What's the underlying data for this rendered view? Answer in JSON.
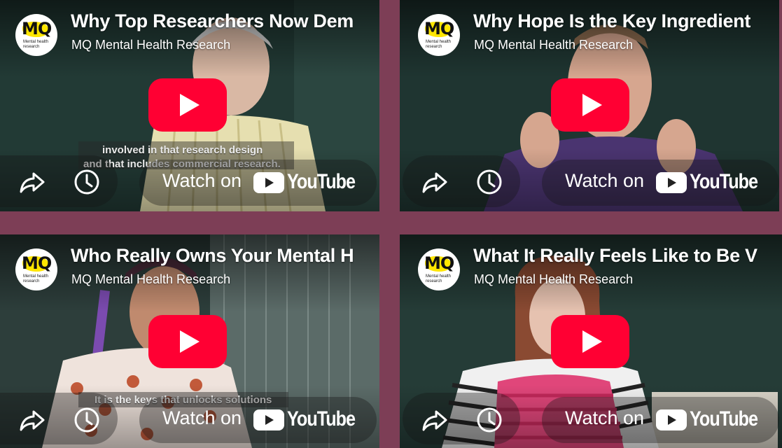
{
  "channel_logo": {
    "text": "MQ",
    "subtext": "Mental health research",
    "accent": "#ffe600"
  },
  "colors": {
    "page_bg": "#7d3e56",
    "play_red": "#ff0033"
  },
  "videos": [
    {
      "title": "Why Top Researchers Now Dem",
      "channel": "MQ Mental Health Research",
      "captions": [
        "involved in that research design",
        "and that includes commercial research."
      ],
      "watch_on": "Watch on",
      "brand": "YouTube"
    },
    {
      "title": "Why Hope Is the Key Ingredient",
      "channel": "MQ Mental Health Research",
      "captions": [],
      "watch_on": "Watch on",
      "brand": "YouTube"
    },
    {
      "title": "Who Really Owns Your Mental H",
      "channel": "MQ Mental Health Research",
      "captions": [
        "It is the keys that unlocks solutions"
      ],
      "watch_on": "Watch on",
      "brand": "YouTube"
    },
    {
      "title": "What It Really Feels Like to Be V",
      "channel": "MQ Mental Health Research",
      "captions": [],
      "watch_on": "Watch on",
      "brand": "YouTube"
    }
  ]
}
